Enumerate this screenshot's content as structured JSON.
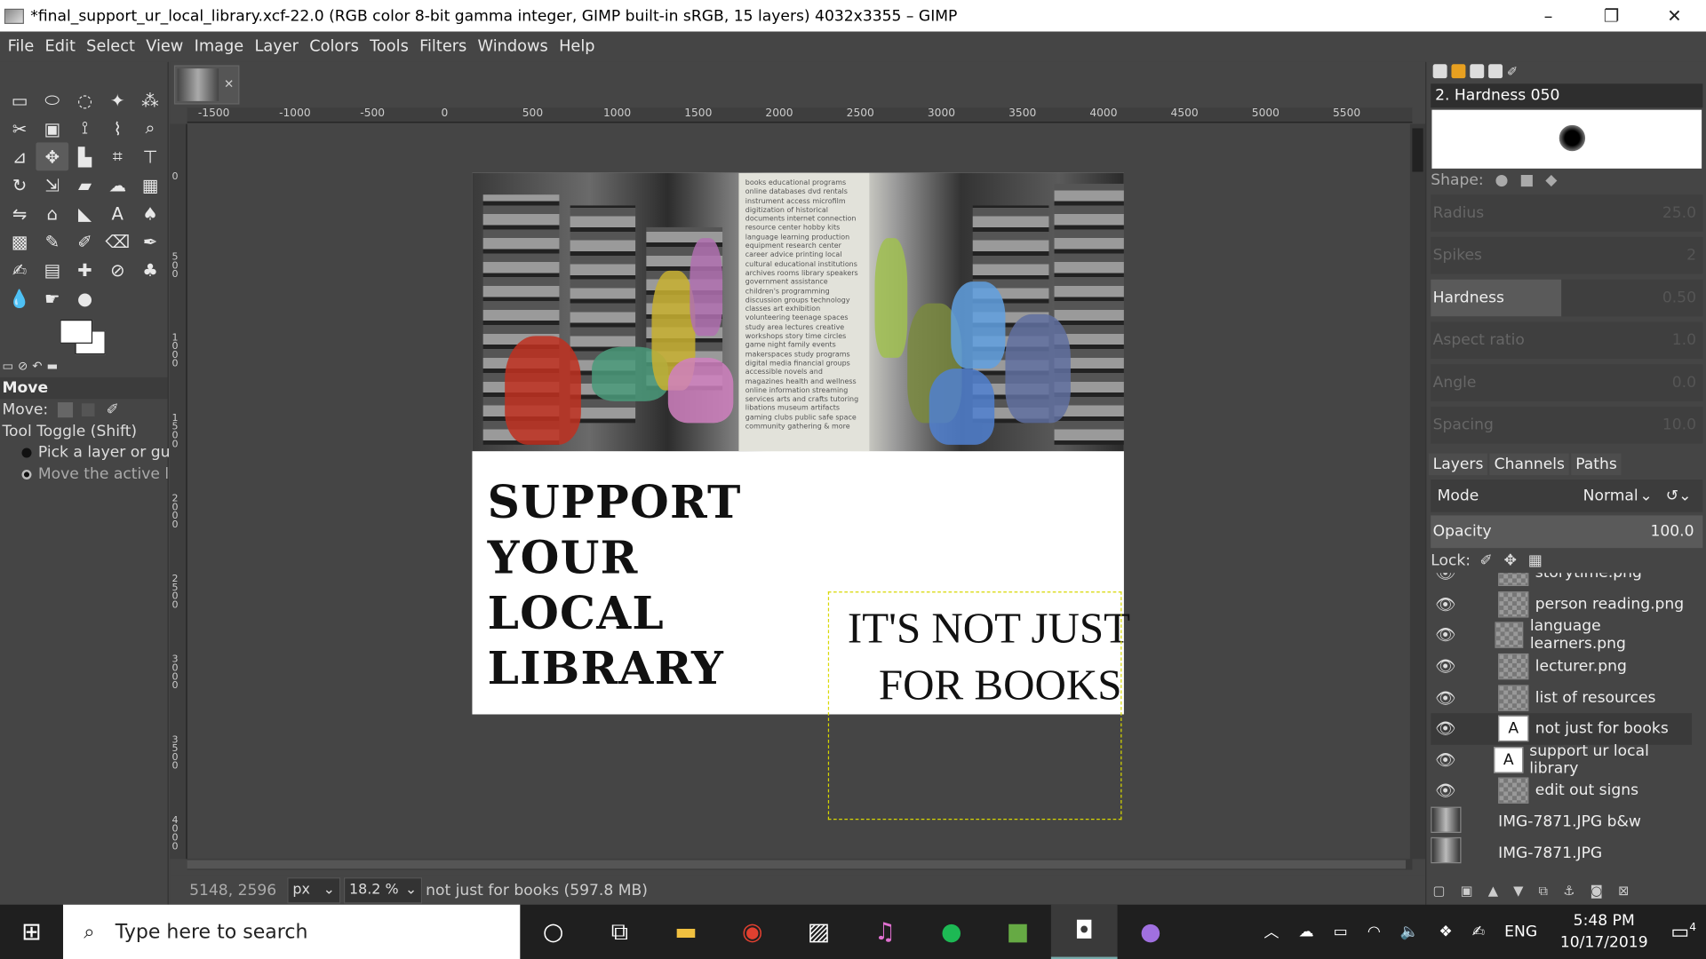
{
  "window": {
    "title": "*final_support_ur_local_library.xcf-22.0 (RGB color 8-bit gamma integer, GIMP built-in sRGB, 15 layers) 4032x3355 – GIMP",
    "minimize": "–",
    "restore": "❐",
    "close": "✕"
  },
  "menu": [
    "File",
    "Edit",
    "Select",
    "View",
    "Image",
    "Layer",
    "Colors",
    "Tools",
    "Filters",
    "Windows",
    "Help"
  ],
  "tool_options": {
    "title": "Move",
    "move_label": "Move:",
    "toggle_label": "Tool Toggle  (Shift)",
    "option1": "Pick a layer or guide",
    "option2": "Move the active layer"
  },
  "ruler": {
    "h_ticks": [
      "-1500",
      "-1000",
      "-500",
      "0",
      "500",
      "1000",
      "1500",
      "2000",
      "2500",
      "3000",
      "3500",
      "4000",
      "4500",
      "5000",
      "5500"
    ],
    "v_ticks": [
      "0",
      "500",
      "1000",
      "1500",
      "2000",
      "2500",
      "3000",
      "3500",
      "4000"
    ]
  },
  "poster": {
    "headline": [
      "SUPPORT",
      "YOUR",
      "LOCAL",
      "LIBRARY"
    ],
    "tagline1": "IT'S NOT JUST",
    "tagline2": "FOR BOOKS",
    "pillar_text": "books educational programs online databases dvd rentals instrument access microfilm digitization of historical documents internet connection resource center hobby kits language learning production equipment research center career advice printing local cultural educational institutions archives rooms library speakers government assistance children's programming discussion groups technology classes art exhibition volunteering teenage spaces study area lectures creative workshops story time circles game night family events makerspaces study programs digital media financial groups accessible novels and magazines health and wellness online information streaming services arts and crafts tutoring libations museum artifacts gaming clubs public safe space community gathering & more"
  },
  "status": {
    "coords": "5148, 2596",
    "unit": "px",
    "zoom": "18.2 %",
    "message": "not just for books (597.8 MB)"
  },
  "brushes": {
    "name": "2. Hardness 050",
    "shape_label": "Shape:",
    "params": [
      {
        "label": "Radius",
        "value": "25.0"
      },
      {
        "label": "Spikes",
        "value": "2"
      },
      {
        "label": "Hardness",
        "value": "0.50"
      },
      {
        "label": "Aspect ratio",
        "value": "1.0"
      },
      {
        "label": "Angle",
        "value": "0.0"
      },
      {
        "label": "Spacing",
        "value": "10.0"
      }
    ]
  },
  "layers_panel": {
    "tabs": [
      "Layers",
      "Channels",
      "Paths"
    ],
    "mode_label": "Mode",
    "mode_value": "Normal",
    "opacity_label": "Opacity",
    "opacity_value": "100.0",
    "lock_label": "Lock:",
    "layers": [
      {
        "name": "storytime.png",
        "type": "image"
      },
      {
        "name": "person reading.png",
        "type": "image"
      },
      {
        "name": "language learners.png",
        "type": "image"
      },
      {
        "name": "lecturer.png",
        "type": "image"
      },
      {
        "name": "list of resources",
        "type": "image"
      },
      {
        "name": "not just for books",
        "type": "text",
        "selected": true
      },
      {
        "name": "support ur local library",
        "type": "text"
      },
      {
        "name": "edit out signs",
        "type": "image"
      },
      {
        "name": "IMG-7871.JPG b&w",
        "type": "photo"
      },
      {
        "name": "IMG-7871.JPG",
        "type": "photo"
      }
    ]
  },
  "taskbar": {
    "search_placeholder": "Type here to search",
    "lang": "ENG",
    "time": "5:48 PM",
    "date": "10/17/2019",
    "notifications": "4"
  }
}
